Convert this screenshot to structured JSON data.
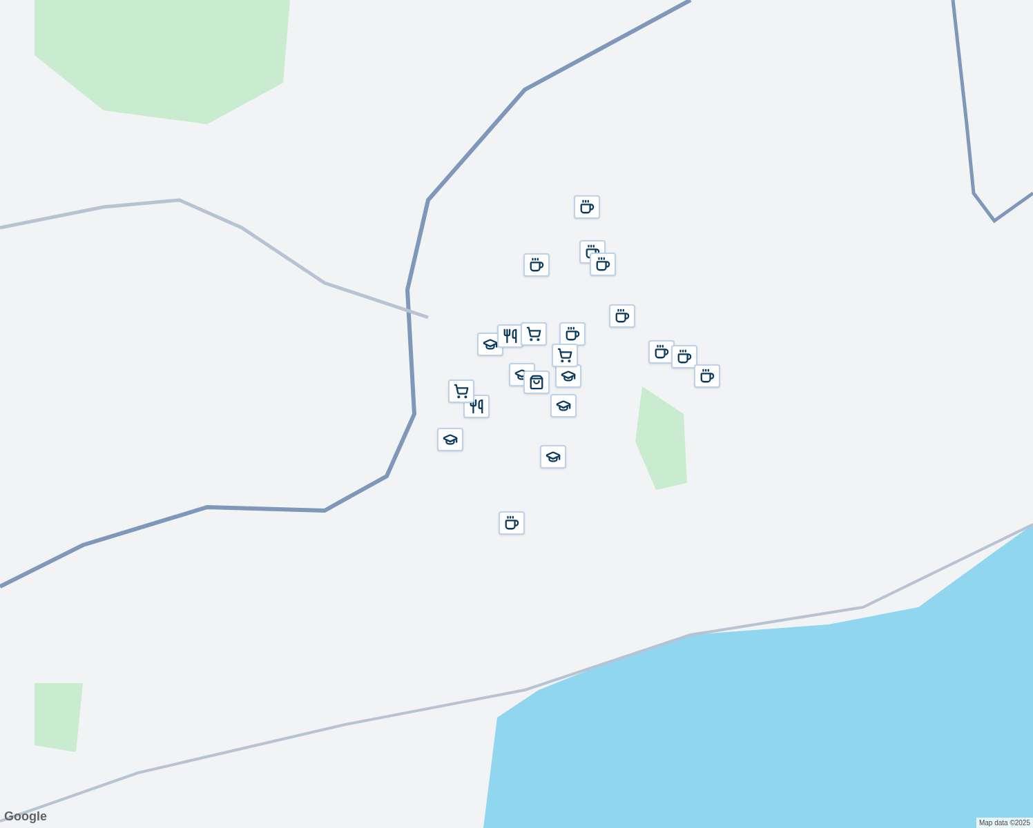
{
  "map": {
    "markers": [
      {
        "kind": "cafe"
      },
      {
        "kind": "cafe"
      },
      {
        "kind": "cafe"
      },
      {
        "kind": "cafe"
      },
      {
        "kind": "cafe"
      },
      {
        "kind": "cafe"
      },
      {
        "kind": "cafe"
      },
      {
        "kind": "cafe"
      },
      {
        "kind": "cafe"
      },
      {
        "kind": "cafe"
      },
      {
        "kind": "school"
      },
      {
        "kind": "school"
      },
      {
        "kind": "school"
      },
      {
        "kind": "school"
      },
      {
        "kind": "school"
      },
      {
        "kind": "school"
      },
      {
        "kind": "restaurant"
      },
      {
        "kind": "restaurant"
      },
      {
        "kind": "cart"
      },
      {
        "kind": "cart"
      },
      {
        "kind": "cart"
      },
      {
        "kind": "bag"
      }
    ]
  },
  "logo": "Google",
  "attribution": "Map data ©2025"
}
